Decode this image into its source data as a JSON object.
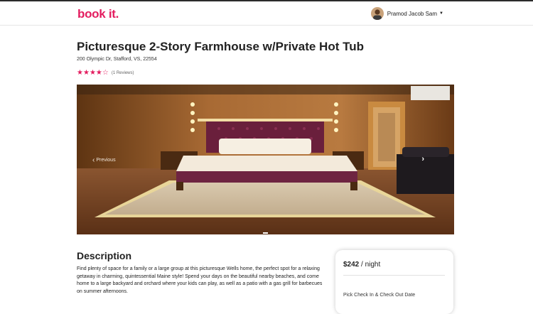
{
  "brand": {
    "logo_text": "book it.",
    "color": "#e31c5f"
  },
  "navbar": {
    "user_name": "Pramod Jacob Sam",
    "avatar_icon": "avatar-photo",
    "caret_icon": "caret-down-icon"
  },
  "listing": {
    "title": "Picturesque 2-Story Farmhouse w/Private Hot Tub",
    "address": "200 Olympic Dr, Stafford, VS, 22554",
    "rating": {
      "value": 4,
      "max": 5,
      "reviews_label": "(1 Reviews)"
    }
  },
  "carousel": {
    "prev_label": "Previous",
    "prev_icon": "chevron-left-icon",
    "next_icon": "chevron-right-icon",
    "slide_count": 1,
    "active_slide": 1
  },
  "description": {
    "heading": "Description",
    "text": "Find plenty of space for a family or a large group at this picturesque Wells home, the perfect spot for a relaxing getaway in charming, quintessential Maine style! Spend your days on the beautiful nearby beaches, and come home to a large backyard and orchard where your kids can play, as well as a patio with a gas grill for barbecues on summer afternoons."
  },
  "booking": {
    "price": "$242",
    "per_night": "/ night",
    "pick_dates_label": "Pick Check In & Check Out Date"
  }
}
